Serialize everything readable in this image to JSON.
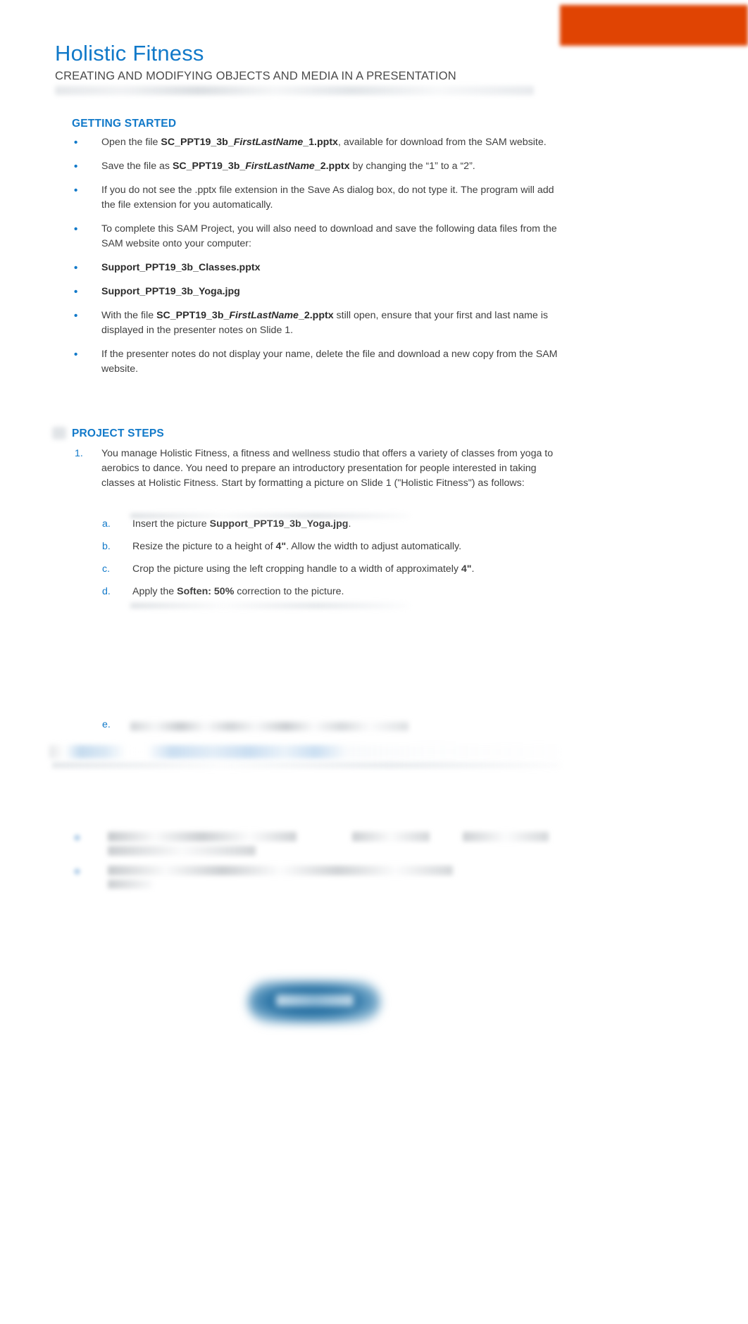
{
  "document": {
    "title": "Holistic Fitness",
    "subtitle": "CREATING AND MODIFYING OBJECTS AND MEDIA IN A PRESENTATION",
    "redacted_header_note": ""
  },
  "brand": {
    "accent_orange": "#e04403",
    "accent_blue": "#1179c9",
    "body_text": "#3f3f3f"
  },
  "getting_started": {
    "heading": "GETTING STARTED",
    "bullet_char": "•",
    "items": [
      {
        "id": "open-file",
        "parts": [
          {
            "text": "Open the file ",
            "style": "normal"
          },
          {
            "text": "SC_PPT19_3b_",
            "style": "bold"
          },
          {
            "text": "FirstLastName",
            "style": "bold-italic"
          },
          {
            "text": "_1.pptx",
            "style": "bold"
          },
          {
            "text": ", available for download from the SAM website.",
            "style": "normal"
          }
        ]
      },
      {
        "id": "save-file",
        "parts": [
          {
            "text": "Save the file as ",
            "style": "normal"
          },
          {
            "text": "SC_PPT19_3b_",
            "style": "bold"
          },
          {
            "text": "FirstLastName",
            "style": "bold-italic"
          },
          {
            "text": "_2.pptx",
            "style": "bold"
          },
          {
            "text": " by changing the “1” to a “2”.",
            "style": "normal"
          }
        ]
      },
      {
        "id": "file-extension-note",
        "parts": [
          {
            "text": "If you do not see the .pptx file extension in the Save As dialog box, do not type it. The program will add the file extension for you automatically.",
            "style": "normal"
          }
        ]
      },
      {
        "id": "download-data-files",
        "parts": [
          {
            "text": "To complete this SAM Project, you will also need to download and save the following data files from the SAM website onto your computer:",
            "style": "normal"
          }
        ]
      },
      {
        "id": "support-classes-file",
        "parts": [
          {
            "text": "Support_PPT19_3b_Classes.pptx",
            "style": "bold"
          }
        ]
      },
      {
        "id": "support-yoga-file",
        "parts": [
          {
            "text": "Support_PPT19_3b_Yoga.jpg",
            "style": "bold"
          }
        ]
      },
      {
        "id": "presenter-notes-check",
        "parts": [
          {
            "text": "With the file ",
            "style": "normal"
          },
          {
            "text": "SC_PPT19_3b_",
            "style": "bold"
          },
          {
            "text": "FirstLastName",
            "style": "bold-italic"
          },
          {
            "text": "_2.pptx",
            "style": "bold"
          },
          {
            "text": " still open, ensure that your first and last name is displayed in the presenter notes on Slide 1.",
            "style": "normal"
          }
        ]
      },
      {
        "id": "redownload-note",
        "parts": [
          {
            "text": "If the presenter notes do not display your name, delete the file and download a new copy from the SAM website.",
            "style": "normal"
          }
        ]
      }
    ]
  },
  "project_steps": {
    "heading": "PROJECT STEPS",
    "steps": [
      {
        "number": "1.",
        "parts": [
          {
            "text": "You manage Holistic Fitness, a fitness and wellness studio that offers a variety of classes from yoga to aerobics to dance. You need to prepare an introductory presentation for people interested in taking classes at Holistic Fitness. Start by formatting a picture on Slide 1 (\"Holistic Fitness\") as follows:",
            "style": "normal"
          }
        ],
        "substeps": [
          {
            "letter": "a.",
            "parts": [
              {
                "text": "Insert the picture ",
                "style": "normal"
              },
              {
                "text": "Support_PPT19_3b_Yoga.jpg",
                "style": "bold"
              },
              {
                "text": ".",
                "style": "normal"
              }
            ]
          },
          {
            "letter": "b.",
            "parts": [
              {
                "text": "Resize the picture to a height of ",
                "style": "normal"
              },
              {
                "text": "4\"",
                "style": "bold"
              },
              {
                "text": ". Allow the width to adjust automatically.",
                "style": "normal"
              }
            ]
          },
          {
            "letter": "c.",
            "parts": [
              {
                "text": "Crop the picture using the left cropping handle to a width of approximately ",
                "style": "normal"
              },
              {
                "text": "4\"",
                "style": "bold"
              },
              {
                "text": ".",
                "style": "normal"
              }
            ]
          },
          {
            "letter": "d.",
            "parts": [
              {
                "text": "Apply the ",
                "style": "normal"
              },
              {
                "text": "Soften: 50%",
                "style": "bold"
              },
              {
                "text": " correction to the picture.",
                "style": "normal"
              }
            ]
          },
          {
            "letter": "e.",
            "parts": [
              {
                "text": "",
                "style": "redacted"
              }
            ]
          }
        ]
      },
      {
        "number": "2.",
        "parts": [
          {
            "text": "",
            "style": "redacted"
          }
        ],
        "substeps": []
      }
    ]
  },
  "redacted_regions": [
    {
      "id": "header-note",
      "description": "blurred text line under subtitle"
    },
    {
      "id": "substep-e",
      "description": "blurred substep e text"
    },
    {
      "id": "step-2",
      "description": "blurred step 2 row"
    },
    {
      "id": "lower-block",
      "description": "blurred bullet block lower page"
    },
    {
      "id": "bottom-pill",
      "description": "blurred blue rounded button"
    },
    {
      "id": "brand-logo",
      "description": "blurred orange logo block top right"
    }
  ]
}
